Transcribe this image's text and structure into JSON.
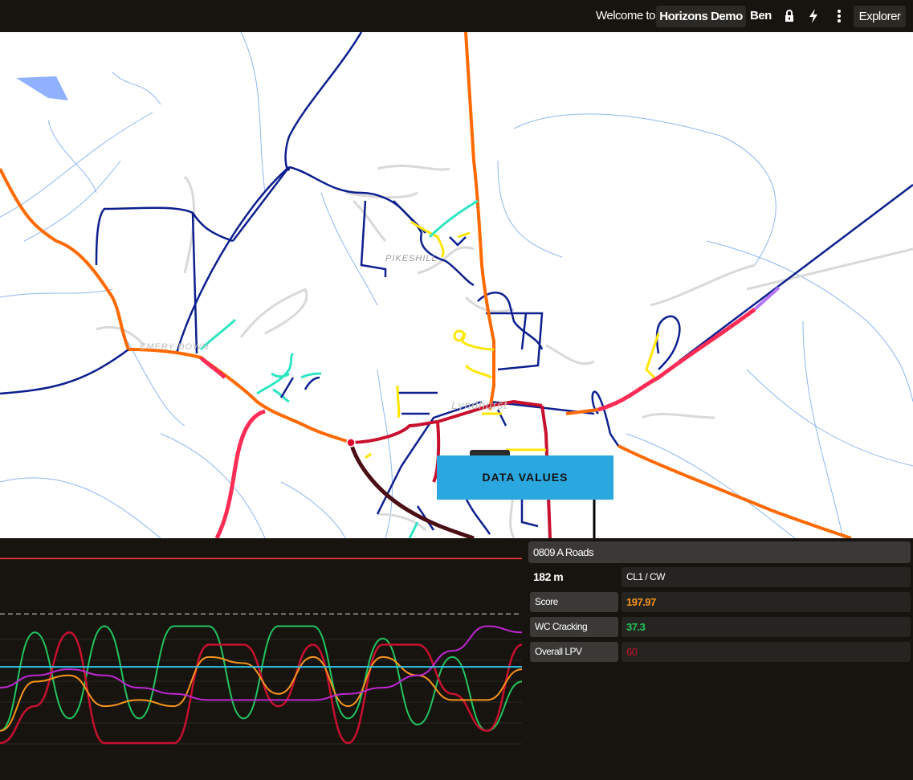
{
  "topbar": {
    "welcome": "Welcome to",
    "project": "Horizons Demo",
    "user": "Ben",
    "explorer": "Explorer",
    "icons": [
      "lock-icon",
      "lightning-icon",
      "more-vertical-icon"
    ]
  },
  "map": {
    "labels": {
      "pikeshill": "PIKESHILL",
      "emery_down": "EMERY DOWN",
      "lyndhurst": "Lyndhurst"
    },
    "road_colors": {
      "good": "#0c1f8f",
      "moderate": "#ffe600",
      "poor": "#ff6a00",
      "very_poor": "#ff2d55",
      "critical": "#c8102e",
      "other": "#2ee6c3"
    }
  },
  "callout": {
    "text": "DATA VALUES"
  },
  "info": {
    "road_name": "0809 A Roads",
    "length": "182 m",
    "lane": "CL1 / CW",
    "rows": [
      {
        "label": "Score",
        "value": "197.97",
        "color": "#f7941d"
      },
      {
        "label": "WC Cracking",
        "value": "37.3",
        "color": "#22c55e"
      },
      {
        "label": "Overall LPV",
        "value": "60",
        "color": "#c8102e"
      }
    ]
  },
  "chart_data": {
    "type": "line",
    "title": "",
    "xlabel": "",
    "ylabel": "",
    "series": [
      {
        "color": "#22c55e",
        "values": [
          0.1,
          0.9,
          0.2,
          0.95,
          0.2,
          0.95,
          0.95,
          0.2,
          0.95,
          0.95,
          0.2,
          0.85,
          0.15,
          0.7,
          0.1,
          0.5
        ]
      },
      {
        "color": "#c8102e",
        "values": [
          0.0,
          0.3,
          0.9,
          0.0,
          0.0,
          0.0,
          0.8,
          0.8,
          0.3,
          0.8,
          0.0,
          0.8,
          0.8,
          0.4,
          0.1,
          0.8
        ]
      },
      {
        "color": "#f7941d",
        "values": [
          0.1,
          0.5,
          0.55,
          0.3,
          0.35,
          0.3,
          0.7,
          0.65,
          0.4,
          0.7,
          0.3,
          0.7,
          0.55,
          0.35,
          0.35,
          0.6
        ]
      },
      {
        "color": "#c026d3",
        "values": [
          0.45,
          0.55,
          0.6,
          0.55,
          0.45,
          0.4,
          0.35,
          0.35,
          0.35,
          0.35,
          0.4,
          0.45,
          0.55,
          0.75,
          0.95,
          0.9
        ]
      },
      {
        "color": "#2ec4e6",
        "values": [
          0.62,
          0.62,
          0.62,
          0.62,
          0.62,
          0.62,
          0.62,
          0.62,
          0.62,
          0.62,
          0.62,
          0.62,
          0.62,
          0.62,
          0.62,
          0.62
        ]
      }
    ],
    "thresholds": [
      {
        "color": "#ff3b3b",
        "value": 1.5
      },
      {
        "color": "#9a9a9a",
        "value": 1.05
      }
    ],
    "ylim": [
      0,
      1.6
    ]
  }
}
